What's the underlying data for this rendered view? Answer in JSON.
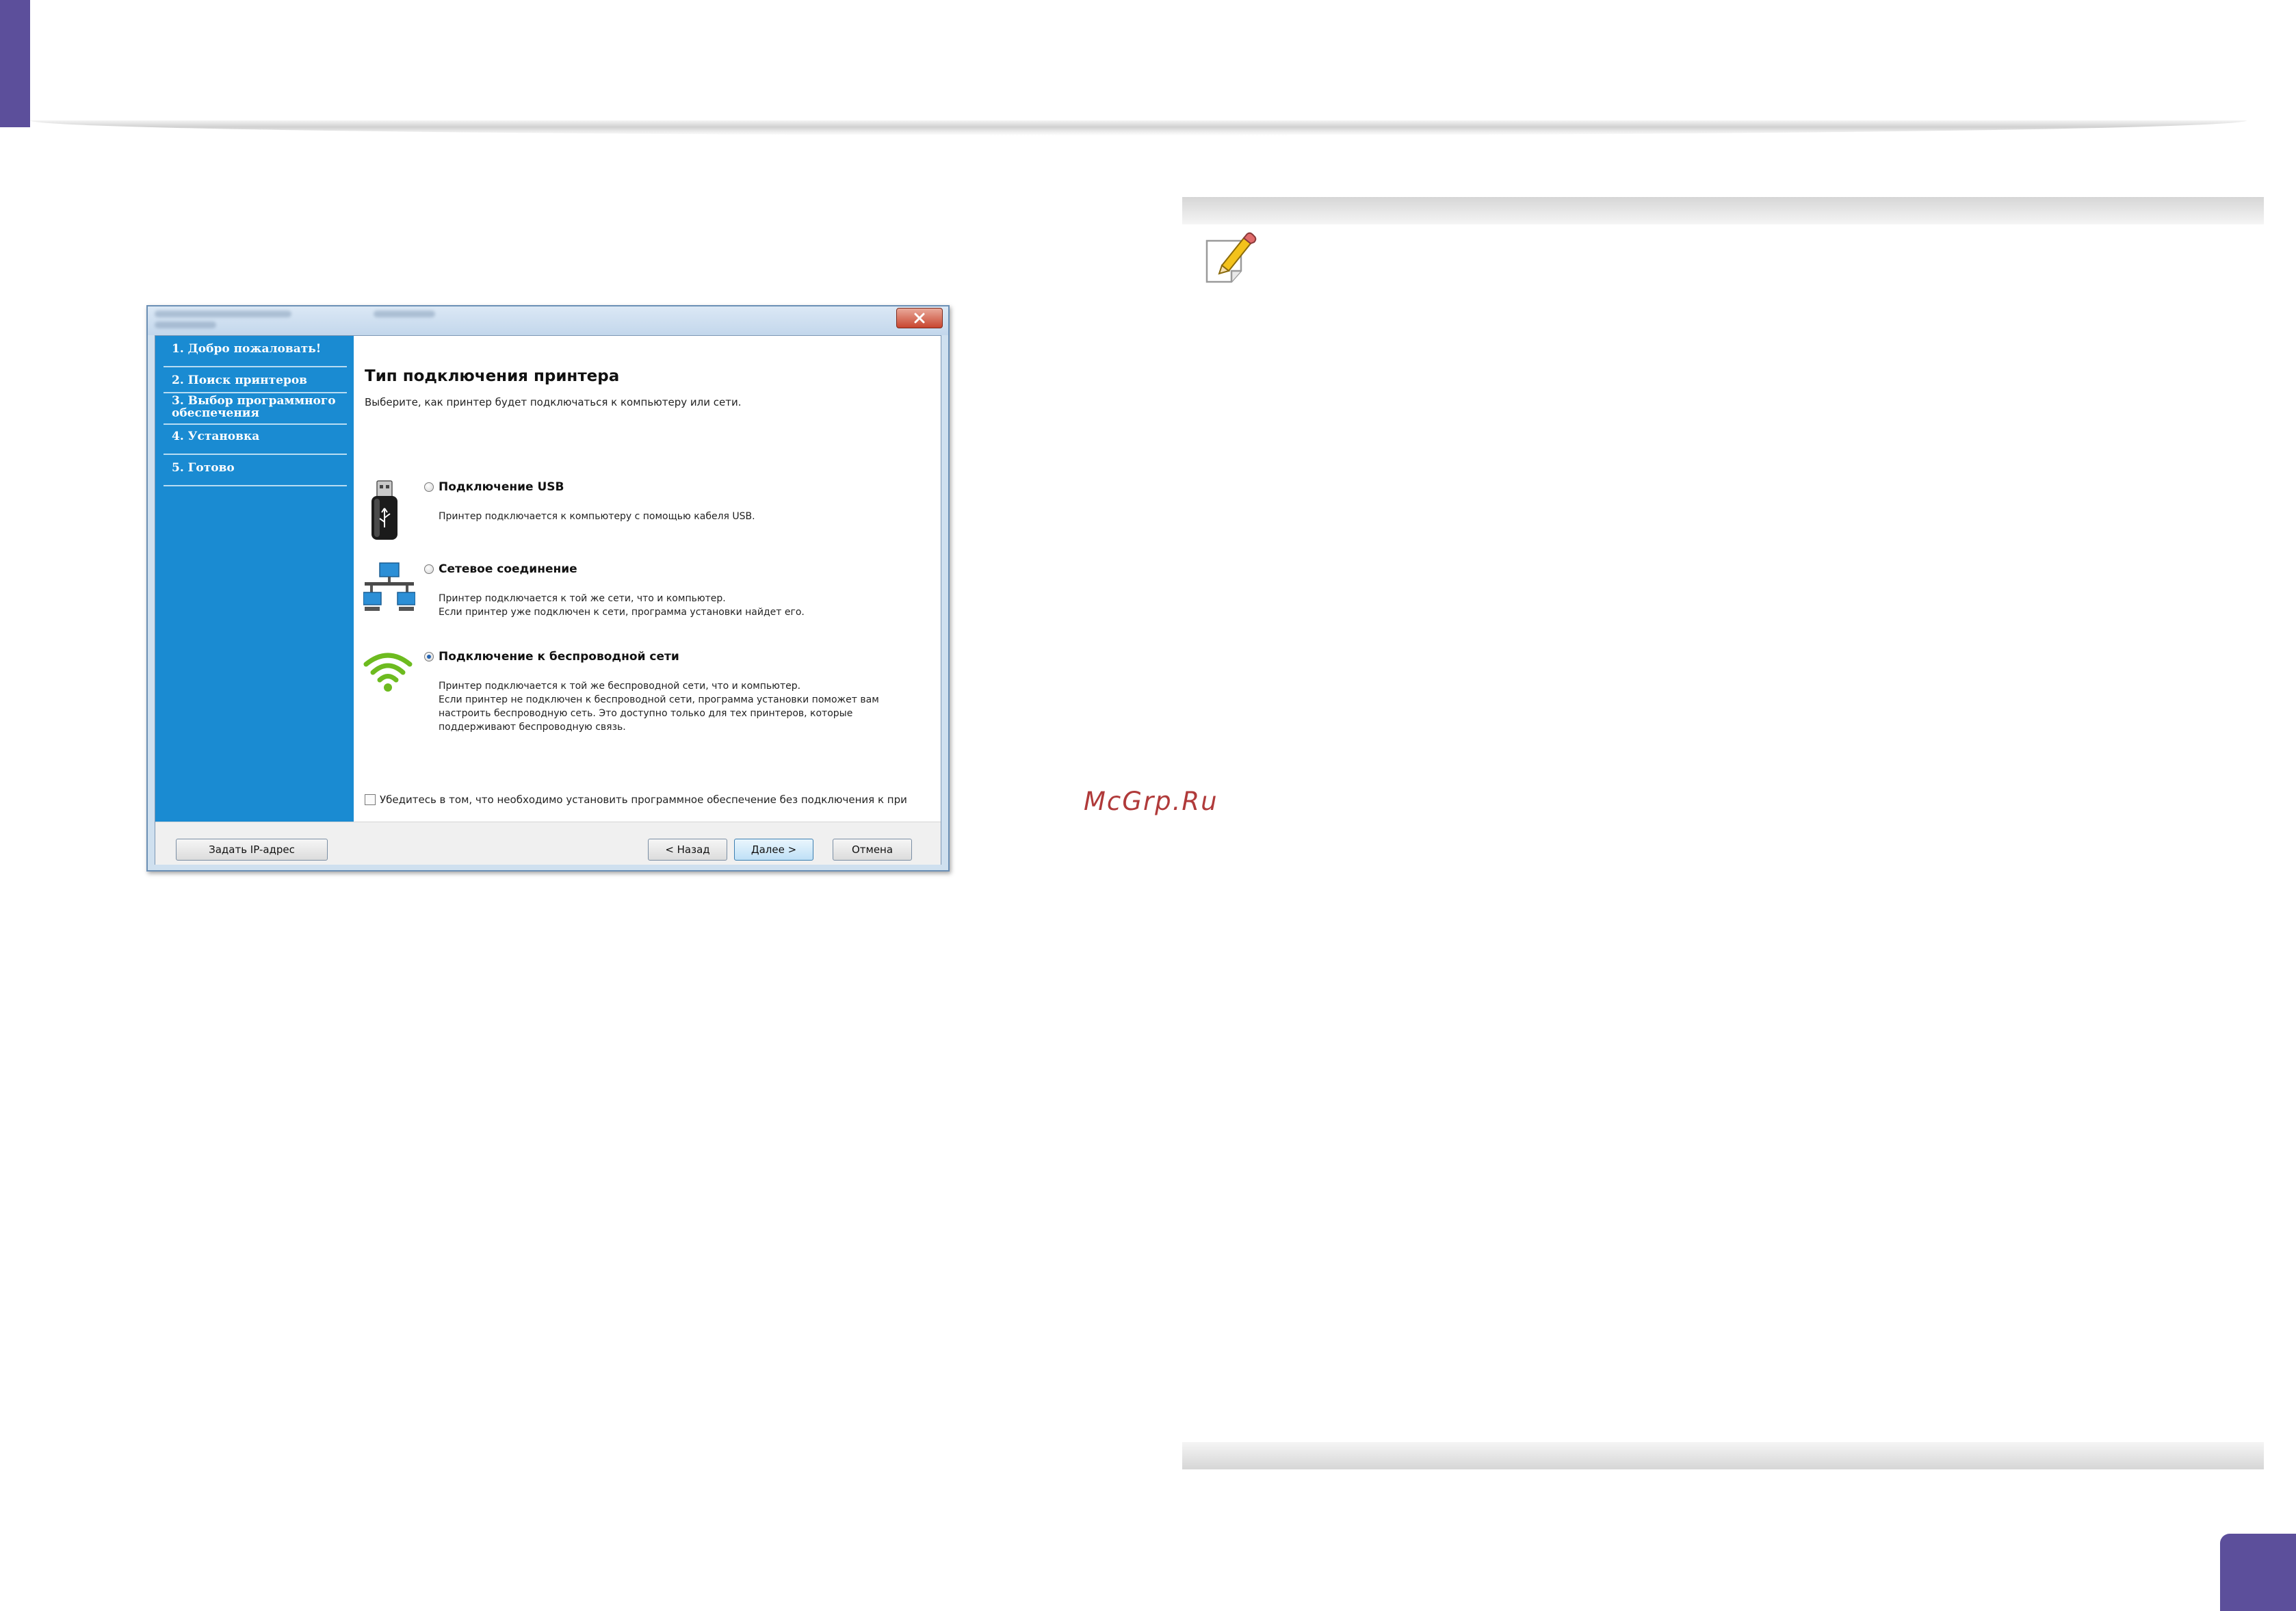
{
  "watermark": "McGrp.Ru",
  "installer": {
    "steps": [
      "1. Добро пожаловать!",
      "2. Поиск принтеров",
      "3. Выбор программного обеспечения",
      "4. Установка",
      "5. Готово"
    ],
    "title": "Тип подключения принтера",
    "subtitle": "Выберите, как принтер будет подключаться к компьютеру или сети.",
    "options": [
      {
        "label": "Подключение USB",
        "description": [
          "Принтер подключается к компьютеру с помощью кабеля USB."
        ],
        "selected": false,
        "icon": "usb-icon"
      },
      {
        "label": "Сетевое соединение",
        "description": [
          "Принтер подключается к той же сети, что и компьютер.",
          "Если принтер уже подключен к сети, программа установки найдет его."
        ],
        "selected": false,
        "icon": "network-icon"
      },
      {
        "label": "Подключение к беспроводной сети",
        "description": [
          "Принтер подключается к той же беспроводной сети, что и компьютер.",
          "Если принтер не подключен к беспроводной сети, программа установки поможет вам",
          "настроить беспроводную сеть. Это доступно только для тех принтеров, которые",
          "поддерживают беспроводную связь."
        ],
        "selected": true,
        "icon": "wifi-icon"
      }
    ],
    "skip_checkbox": {
      "label": "Убедитесь в том, что необходимо установить программное обеспечение без подключения к при",
      "checked": false
    },
    "buttons": {
      "set_ip": "Задать IP-адрес",
      "back": "< Назад",
      "next": "Далее >",
      "cancel": "Отмена"
    }
  },
  "colors": {
    "accent": "#5c4f9b",
    "sidebar": "#1a8bd2",
    "watermark": "#b03a3a"
  }
}
